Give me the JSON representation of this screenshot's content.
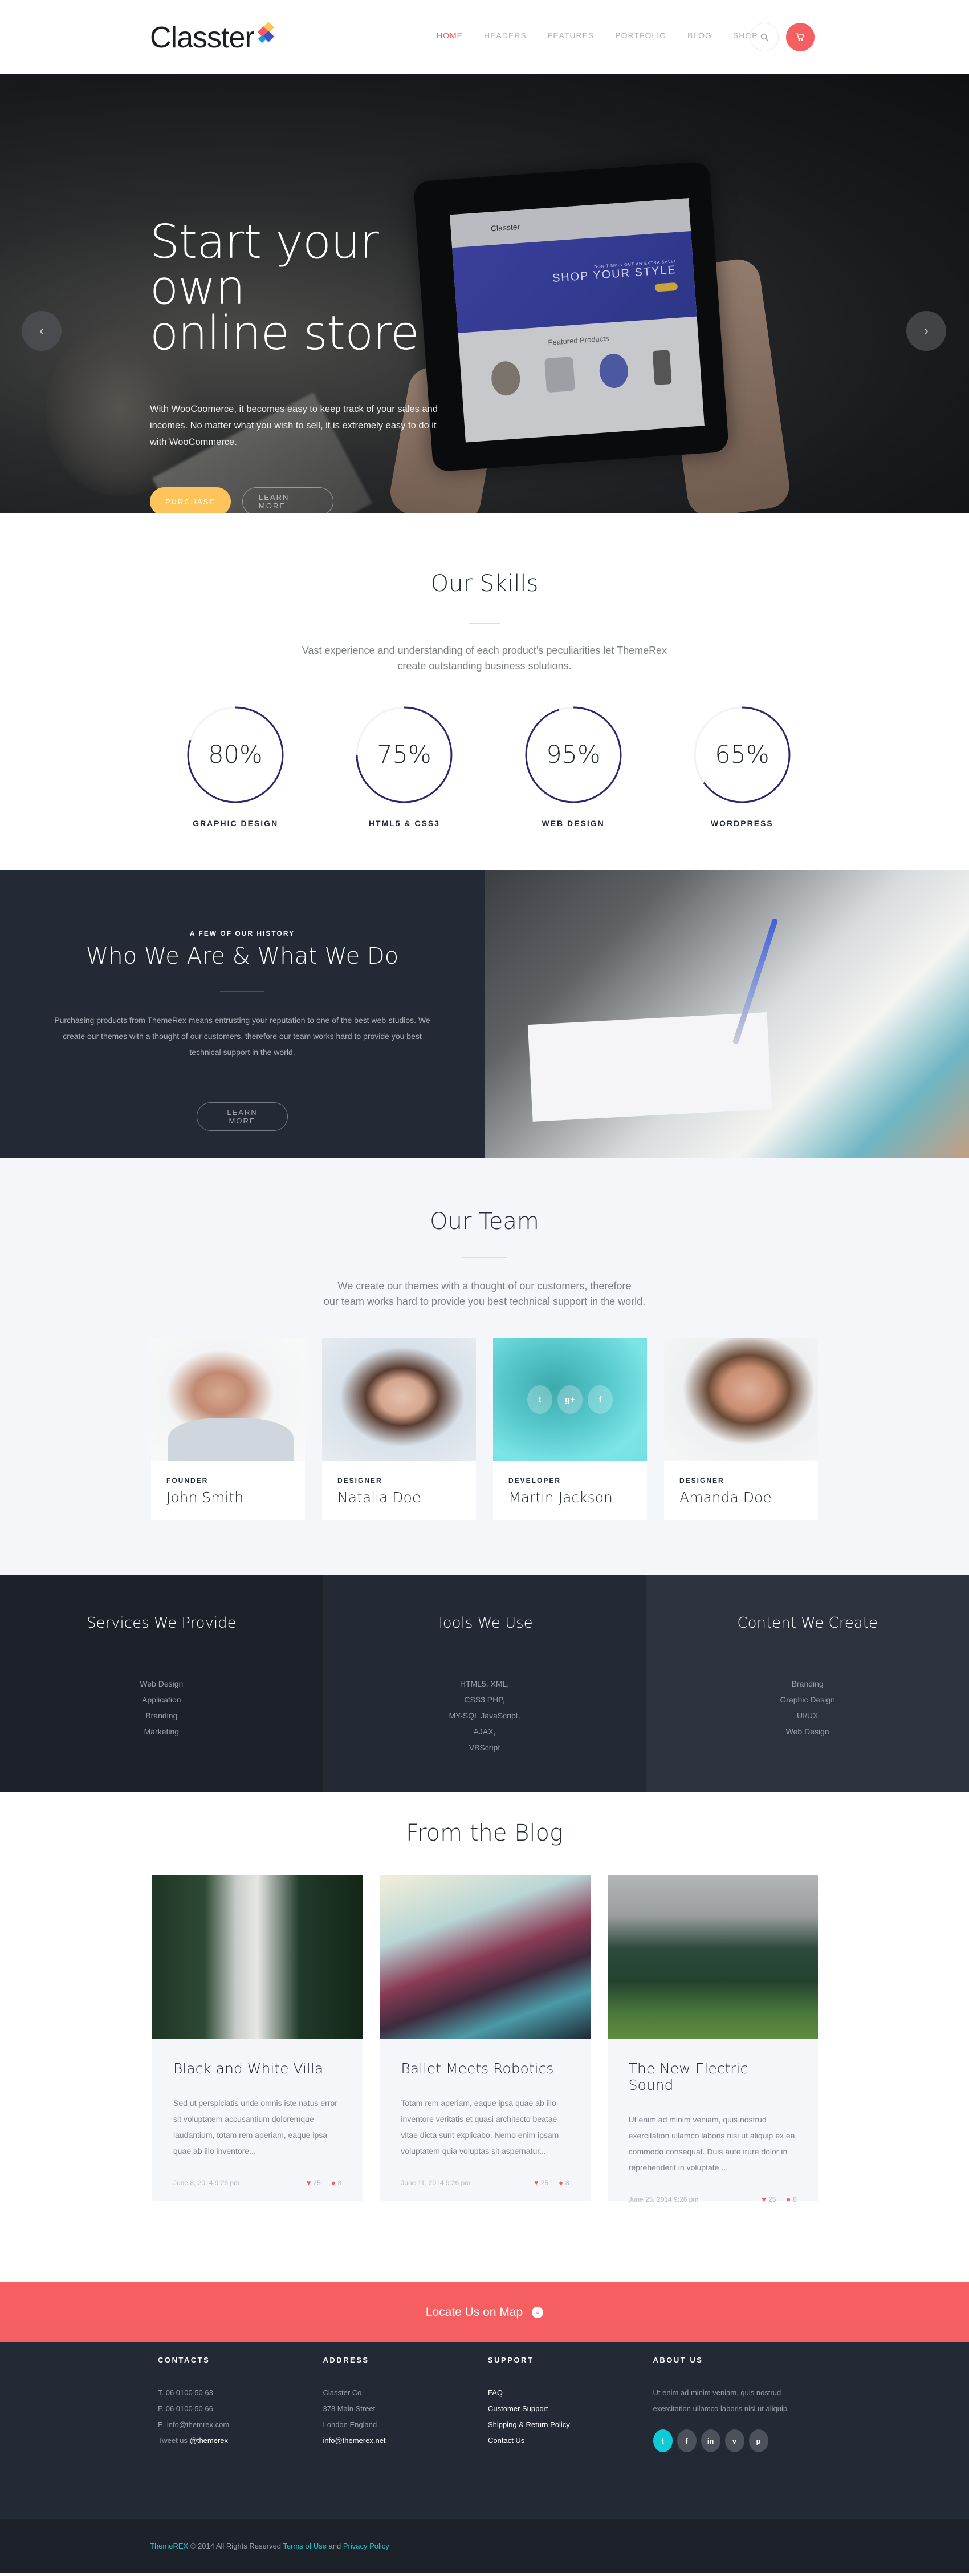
{
  "header": {
    "logo": "Classter",
    "nav": [
      {
        "label": "HOME",
        "active": true
      },
      {
        "label": "HEADERS",
        "active": false
      },
      {
        "label": "FEATURES",
        "active": false
      },
      {
        "label": "PORTFOLIO",
        "active": false
      },
      {
        "label": "BLOG",
        "active": false
      },
      {
        "label": "SHOP",
        "active": false
      }
    ],
    "search_icon": "search-icon",
    "cart_icon": "cart-icon"
  },
  "hero": {
    "title_line1": "Start your own",
    "title_line2": "online store",
    "text": "With WooCoomerce, it becomes easy to keep track of your sales and incomes. No matter what you wish to sell, it is extremely easy to do it with WooCommerce.",
    "purchase_label": "PURCHASE",
    "learn_more_label": "LEARN MORE",
    "prev_icon": "‹",
    "next_icon": "›",
    "slides": 3,
    "active_slide": 2,
    "tablet": {
      "logo": "Classter",
      "banner_kicker": "DON'T MISS OUT AN EXTRA SALE!",
      "banner_title": "SHOP YOUR STYLE",
      "featured": "Featured Products"
    }
  },
  "skills": {
    "title": "Our Skills",
    "subtitle_line1": "Vast experience and understanding of each product’s peculiarities let ThemeRex",
    "subtitle_line2": "create outstanding business solutions.",
    "items": [
      {
        "label": "GRAPHIC DESIGN",
        "value": 80,
        "display": "80%"
      },
      {
        "label": "HTML5 & CSS3",
        "value": 75,
        "display": "75%"
      },
      {
        "label": "WEB DESIGN",
        "value": 95,
        "display": "95%"
      },
      {
        "label": "WORDPRESS",
        "value": 65,
        "display": "65%"
      }
    ],
    "ring_color": "#33236f",
    "track_color": "#f1f2f4"
  },
  "about": {
    "kicker": "A FEW OF OUR HISTORY",
    "title": "Who We Are & What We Do",
    "text": "Purchasing products from ThemeRex means entrusting your reputation to one of the best web-studios. We create our themes with a thought of our customers, therefore our team works hard to provide you best technical support in the world.",
    "button": "LEARN MORE"
  },
  "team": {
    "title": "Our Team",
    "subtitle_line1": "We create our themes with a thought of our customers, therefore",
    "subtitle_line2": "our team works hard to provide you best technical support in the world.",
    "members": [
      {
        "role": "FOUNDER",
        "name": "John Smith"
      },
      {
        "role": "DESIGNER",
        "name": "Natalia Doe"
      },
      {
        "role": "DEVELOPER",
        "name": "Martin Jackson"
      },
      {
        "role": "DESIGNER",
        "name": "Amanda Doe"
      }
    ],
    "hover_socials": [
      "t",
      "g+",
      "f"
    ]
  },
  "services": [
    {
      "title": "Services We Provide",
      "items": [
        "Web Design",
        "Application",
        "Branding",
        "Marketing"
      ]
    },
    {
      "title": "Tools  We Use",
      "items": [
        "HTML5, XML,",
        "CSS3 PHP,",
        "MY-SQL JavaScript,",
        "AJAX,",
        "VBScript"
      ]
    },
    {
      "title": "Content We Create",
      "items": [
        "Branding",
        "Graphic Design",
        "UI/UX",
        "Web Design"
      ]
    }
  ],
  "blog": {
    "title": "From the Blog",
    "posts": [
      {
        "title": "Black and White Villa",
        "excerpt": "Sed ut perspiciatis unde omnis iste natus error sit voluptatem accusantium doloremque laudantium, totam rem aperiam, eaque ipsa quae ab illo inventore...",
        "date": "June 8, 2014 9:26 pm",
        "likes": "25",
        "comments": "8"
      },
      {
        "title": "Ballet Meets Robotics",
        "excerpt": "Totam rem aperiam, eaque ipsa quae ab illo inventore veritatis et quasi architecto beatae vitae dicta sunt explicabo. Nemo enim ipsam voluptatem quia voluptas sit aspernatur...",
        "date": "June 11, 2014 9:26 pm",
        "likes": "25",
        "comments": "8"
      },
      {
        "title": "The New Electric Sound",
        "excerpt": "Ut enim ad minim veniam, quis nostrud exercitation ullamco laboris nisi ut aliquip ex ea commodo consequat. Duis aute irure dolor in reprehenderit in voluptate ...",
        "date": "June 25, 2014 9:26 pm",
        "likes": "25",
        "comments": "8"
      }
    ]
  },
  "locate": {
    "label": "Locate Us on Map"
  },
  "footer": {
    "contacts": {
      "title": "CONTACTS",
      "phone": "T. 06 0100 50 63",
      "fax": "F. 06 0100 50 66",
      "email": "E. info@themrex.com",
      "tweet_prefix": "Tweet us ",
      "tweet_handle": "@themerex"
    },
    "address": {
      "title": "ADDRESS",
      "lines": [
        "Classter Co.",
        "378 Main Street",
        "London England"
      ],
      "email": "info@themerex.net"
    },
    "support": {
      "title": "SUPPORT",
      "links": [
        "FAQ",
        "Customer Support",
        "Shipping & Return Policy",
        "Contact Us"
      ]
    },
    "about": {
      "title": "ABOUT US",
      "text": "Ut enim ad minim veniam, quis nostrud exercitation ullamco laboris nisi ut aliquip",
      "socials": [
        {
          "name": "twitter",
          "glyph": "t",
          "active": true
        },
        {
          "name": "facebook",
          "glyph": "f",
          "active": false
        },
        {
          "name": "linkedin",
          "glyph": "in",
          "active": false
        },
        {
          "name": "vimeo",
          "glyph": "v",
          "active": false
        },
        {
          "name": "pinterest",
          "glyph": "p",
          "active": false
        }
      ]
    },
    "copyright": {
      "brand": "ThemeREX",
      "middle": " © 2014 All Rights Reserved ",
      "terms": "Terms of Use",
      "and": " and ",
      "privacy": "Privacy Policy"
    }
  },
  "colors": {
    "accent": "#f65f61",
    "yellow": "#fcc45a",
    "dark": "#232a35",
    "teal": "#0ccdd7",
    "ring": "#33236f"
  }
}
